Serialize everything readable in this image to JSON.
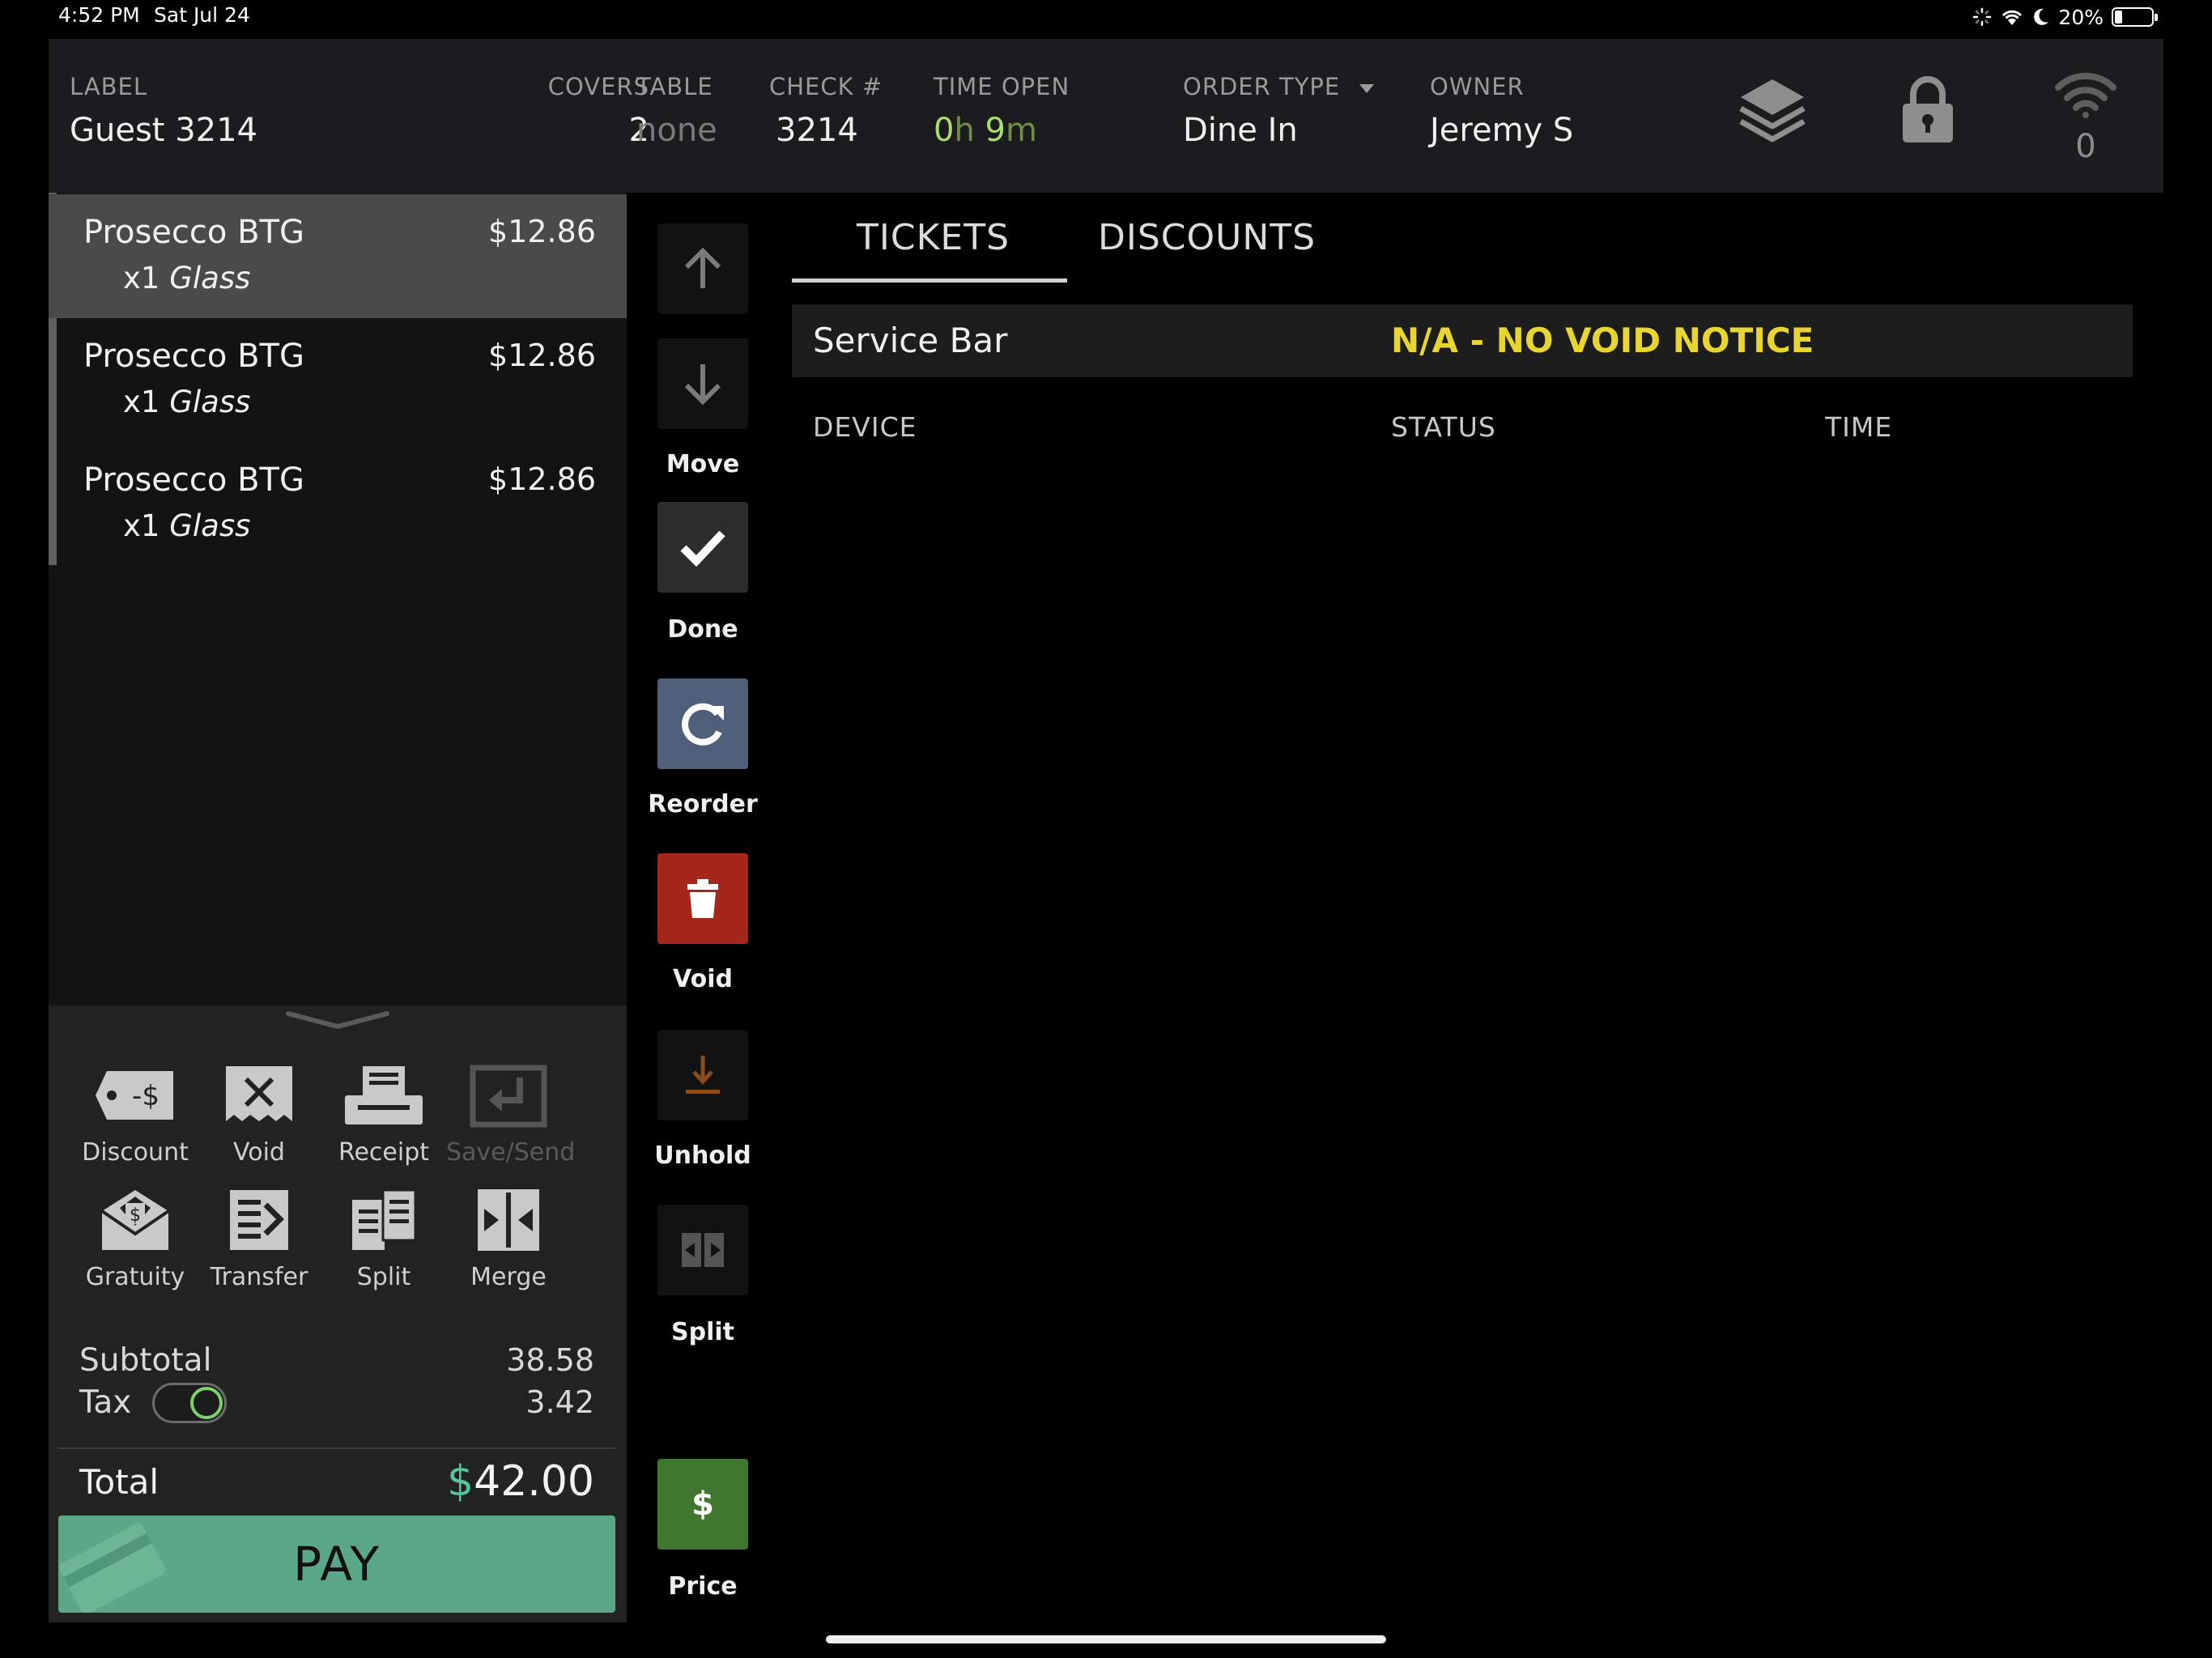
{
  "status_bar": {
    "time": "4:52 PM",
    "date": "Sat Jul 24",
    "battery": "20%"
  },
  "header": {
    "label": {
      "title": "LABEL",
      "value": "Guest 3214"
    },
    "covers": {
      "title": "COVERS",
      "value": "2"
    },
    "table": {
      "title": "TABLE",
      "value": "none"
    },
    "check": {
      "title": "CHECK #",
      "value": "3214"
    },
    "time_open": {
      "title": "TIME OPEN",
      "hours": "0",
      "h": "h",
      "minutes": "9",
      "m": "m"
    },
    "order_type": {
      "title": "ORDER TYPE",
      "value": "Dine In"
    },
    "owner": {
      "title": "OWNER",
      "value": "Jeremy S"
    },
    "icons": [
      "layers-icon",
      "lock-icon",
      "wifi-icon"
    ],
    "wifi_count": "0"
  },
  "order": {
    "items": [
      {
        "name": "Prosecco BTG",
        "price": "$12.86",
        "qty": "x1",
        "modifier": "Glass",
        "selected": true
      },
      {
        "name": "Prosecco BTG",
        "price": "$12.86",
        "qty": "x1",
        "modifier": "Glass",
        "selected": false
      },
      {
        "name": "Prosecco BTG",
        "price": "$12.86",
        "qty": "x1",
        "modifier": "Glass",
        "selected": false
      }
    ]
  },
  "actions": {
    "discount": "Discount",
    "void": "Void",
    "receipt": "Receipt",
    "save_send": "Save/Send",
    "gratuity": "Gratuity",
    "transfer": "Transfer",
    "split": "Split",
    "merge": "Merge"
  },
  "totals": {
    "subtotal_label": "Subtotal",
    "subtotal": "38.58",
    "tax_label": "Tax",
    "tax": "3.42",
    "tax_enabled": true,
    "total_label": "Total",
    "currency": "$",
    "total": "42.00",
    "pay_label": "PAY"
  },
  "tools": {
    "move": "Move",
    "done": "Done",
    "reorder": "Reorder",
    "void": "Void",
    "unhold": "Unhold",
    "split": "Split",
    "price": "Price",
    "price_symbol": "$"
  },
  "tabs": {
    "tickets": "TICKETS",
    "discounts": "DISCOUNTS",
    "active": "tickets"
  },
  "tickets": {
    "rows": [
      {
        "name": "Service Bar",
        "status": "N/A - NO VOID NOTICE"
      }
    ],
    "columns": {
      "device": "DEVICE",
      "status": "STATUS",
      "time": "TIME"
    }
  },
  "colors": {
    "accent_green": "#5aa887",
    "void_red": "#a5271a",
    "reorder_blue": "#4f5f79",
    "price_green": "#40772f",
    "notice_yellow": "#e8d531",
    "time_green": "#a9dd6e"
  }
}
